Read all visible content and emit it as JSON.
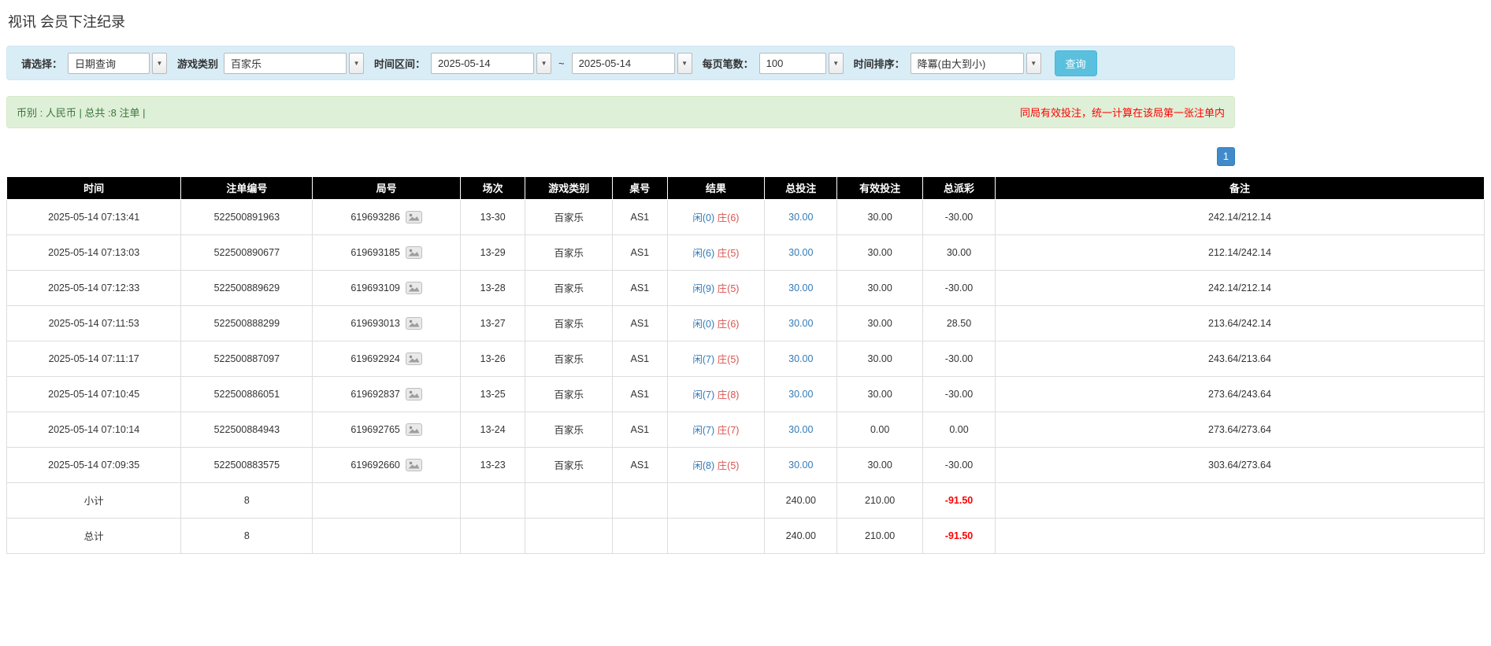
{
  "page": {
    "title": "视讯 会员下注纪录"
  },
  "filters": {
    "select": {
      "label": "请选择：",
      "value": "日期查询"
    },
    "game_type": {
      "label": "游戏类别",
      "value": "百家乐"
    },
    "date_range": {
      "label": "时间区间：",
      "from": "2025-05-14",
      "separator": "~",
      "to": "2025-05-14"
    },
    "page_size": {
      "label": "每页笔数：",
      "value": "100"
    },
    "sort": {
      "label": "时间排序：",
      "value": "降冪(由大到小)"
    },
    "search_button_label": "查询"
  },
  "summary_bar": {
    "left": "币别 : 人民币 | 总共 :8 注单 |",
    "right": "同局有效投注，统一计算在该局第一张注单内"
  },
  "pagination": {
    "current": "1"
  },
  "icons": {
    "dropdown": "chevron-down-icon",
    "round_detail": "image-icon"
  },
  "colors": {
    "accent_blue": "#337ab7",
    "negative_red": "#d9534f",
    "footer_gray": "#9d9d9d",
    "filter_bg": "#d9edf7",
    "summary_bg": "#dff0d8",
    "header_bg": "#000000",
    "search_button_bg": "#5bc0de",
    "pagination_bg": "#428bca"
  },
  "table": {
    "headers": [
      "时间",
      "注单编号",
      "局号",
      "场次",
      "游戏类别",
      "桌号",
      "结果",
      "总投注",
      "有效投注",
      "总派彩",
      "备注"
    ],
    "rows": [
      {
        "time": "2025-05-14 07:13:41",
        "bet_id": "522500891963",
        "round_id": "619693286",
        "session": "13-30",
        "game": "百家乐",
        "table_no": "AS1",
        "result": {
          "player": "闲(0)",
          "banker": "庄(6)"
        },
        "total_bet": "30.00",
        "valid_bet": "30.00",
        "payout": "-30.00",
        "note": "242.14/212.14"
      },
      {
        "time": "2025-05-14 07:13:03",
        "bet_id": "522500890677",
        "round_id": "619693185",
        "session": "13-29",
        "game": "百家乐",
        "table_no": "AS1",
        "result": {
          "player": "闲(6)",
          "banker": "庄(5)"
        },
        "total_bet": "30.00",
        "valid_bet": "30.00",
        "payout": "30.00",
        "note": "212.14/242.14"
      },
      {
        "time": "2025-05-14 07:12:33",
        "bet_id": "522500889629",
        "round_id": "619693109",
        "session": "13-28",
        "game": "百家乐",
        "table_no": "AS1",
        "result": {
          "player": "闲(9)",
          "banker": "庄(5)"
        },
        "total_bet": "30.00",
        "valid_bet": "30.00",
        "payout": "-30.00",
        "note": "242.14/212.14"
      },
      {
        "time": "2025-05-14 07:11:53",
        "bet_id": "522500888299",
        "round_id": "619693013",
        "session": "13-27",
        "game": "百家乐",
        "table_no": "AS1",
        "result": {
          "player": "闲(0)",
          "banker": "庄(6)"
        },
        "total_bet": "30.00",
        "valid_bet": "30.00",
        "payout": "28.50",
        "note": "213.64/242.14"
      },
      {
        "time": "2025-05-14 07:11:17",
        "bet_id": "522500887097",
        "round_id": "619692924",
        "session": "13-26",
        "game": "百家乐",
        "table_no": "AS1",
        "result": {
          "player": "闲(7)",
          "banker": "庄(5)"
        },
        "total_bet": "30.00",
        "valid_bet": "30.00",
        "payout": "-30.00",
        "note": "243.64/213.64"
      },
      {
        "time": "2025-05-14 07:10:45",
        "bet_id": "522500886051",
        "round_id": "619692837",
        "session": "13-25",
        "game": "百家乐",
        "table_no": "AS1",
        "result": {
          "player": "闲(7)",
          "banker": "庄(8)"
        },
        "total_bet": "30.00",
        "valid_bet": "30.00",
        "payout": "-30.00",
        "note": "273.64/243.64"
      },
      {
        "time": "2025-05-14 07:10:14",
        "bet_id": "522500884943",
        "round_id": "619692765",
        "session": "13-24",
        "game": "百家乐",
        "table_no": "AS1",
        "result": {
          "player": "闲(7)",
          "banker": "庄(7)"
        },
        "total_bet": "30.00",
        "valid_bet": "0.00",
        "payout": "0.00",
        "note": "273.64/273.64"
      },
      {
        "time": "2025-05-14 07:09:35",
        "bet_id": "522500883575",
        "round_id": "619692660",
        "session": "13-23",
        "game": "百家乐",
        "table_no": "AS1",
        "result": {
          "player": "闲(8)",
          "banker": "庄(5)"
        },
        "total_bet": "30.00",
        "valid_bet": "30.00",
        "payout": "-30.00",
        "note": "303.64/273.64"
      }
    ],
    "subtotal": {
      "label": "小计",
      "count": "8",
      "total_bet": "240.00",
      "valid_bet": "210.00",
      "payout": "-91.50"
    },
    "total": {
      "label": "总计",
      "count": "8",
      "total_bet": "240.00",
      "valid_bet": "210.00",
      "payout": "-91.50"
    }
  }
}
